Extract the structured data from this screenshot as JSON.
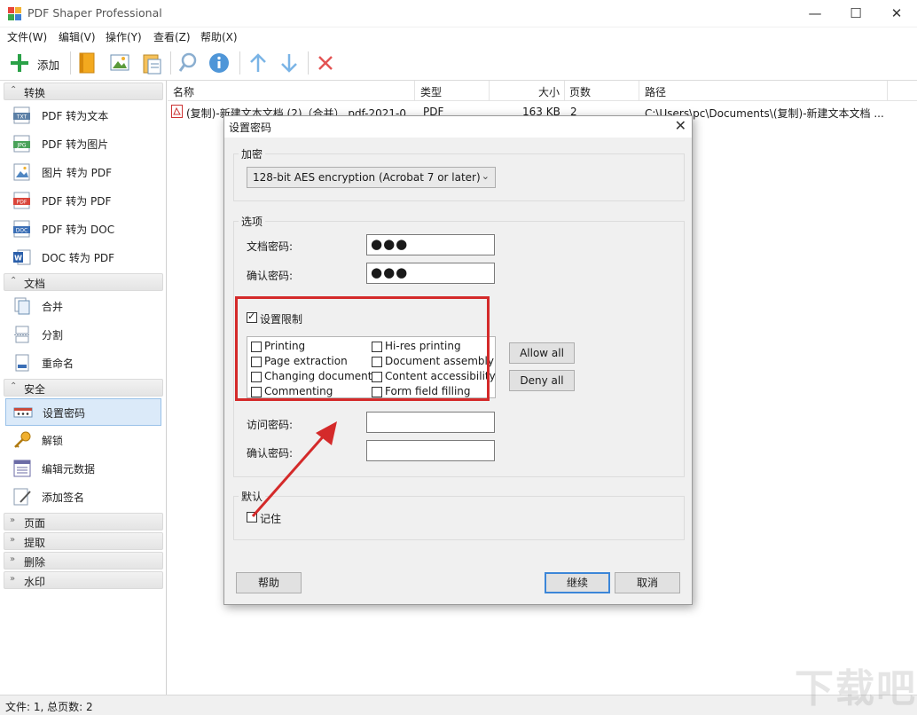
{
  "window": {
    "title": "PDF Shaper Professional",
    "minimize_glyph": "—",
    "maximize_glyph": "☐",
    "close_glyph": "✕"
  },
  "menu": [
    "文件(W)",
    "编辑(V)",
    "操作(Y)",
    "查看(Z)",
    "帮助(X)"
  ],
  "toolbar": {
    "add_label": "添加",
    "icons": [
      "add-icon",
      "bookmark-icon",
      "image-icon",
      "clipboard-icon",
      "search-icon",
      "info-icon",
      "move-up-icon",
      "move-down-icon",
      "remove-icon"
    ]
  },
  "sidebar": {
    "groups": [
      {
        "label": "转换",
        "arrow": "⌃",
        "items": [
          "PDF 转为文本",
          "PDF 转为图片",
          "图片 转为 PDF",
          "PDF 转为 PDF",
          "PDF 转为 DOC",
          "DOC 转为 PDF"
        ]
      },
      {
        "label": "文档",
        "arrow": "⌃",
        "items": [
          "合并",
          "分割",
          "重命名"
        ]
      },
      {
        "label": "安全",
        "arrow": "⌃",
        "items": [
          "设置密码",
          "解锁",
          "编辑元数据",
          "添加签名"
        ]
      },
      {
        "label": "页面",
        "arrow": "»",
        "items": []
      },
      {
        "label": "提取",
        "arrow": "»",
        "items": []
      },
      {
        "label": "删除",
        "arrow": "»",
        "items": []
      },
      {
        "label": "水印",
        "arrow": "»",
        "items": []
      }
    ],
    "selected_item": "设置密码"
  },
  "file_list": {
    "columns": [
      "名称",
      "类型",
      "大小",
      "页数",
      "路径"
    ],
    "rows": [
      {
        "name": "(复制)-新建文本文档 (2)（合并）.pdf-2021-0...",
        "type": "PDF",
        "size": "163 KB",
        "pages": "2",
        "path": "C:\\Users\\pc\\Documents\\(复制)-新建文本文档 ..."
      }
    ]
  },
  "status": "文件: 1, 总页数: 2",
  "dialog": {
    "title": "设置密码",
    "close_glyph": "✕",
    "encryption_group": "加密",
    "encryption_value": "128-bit AES encryption (Acrobat 7 or later)",
    "options_group": "选项",
    "doc_password_label": "文档密码:",
    "doc_password_value": "●●●",
    "confirm_password_label": "确认密码:",
    "confirm_password_value": "●●●",
    "set_restrictions_label": "设置限制",
    "set_restrictions_checked": true,
    "permissions": [
      {
        "label": "Printing",
        "checked": false
      },
      {
        "label": "Hi-res printing",
        "checked": false
      },
      {
        "label": "Page extraction",
        "checked": false
      },
      {
        "label": "Document assembly",
        "checked": false
      },
      {
        "label": "Changing document",
        "checked": false
      },
      {
        "label": "Content accessibility",
        "checked": false
      },
      {
        "label": "Commenting",
        "checked": false
      },
      {
        "label": "Form field filling",
        "checked": false
      }
    ],
    "allow_all_label": "Allow all",
    "deny_all_label": "Deny all",
    "access_password_label": "访问密码:",
    "access_confirm_label": "确认密码:",
    "default_group": "默认",
    "remember_label": "记住",
    "remember_checked": false,
    "help_label": "帮助",
    "continue_label": "继续",
    "cancel_label": "取消"
  },
  "colors": {
    "annotation_red": "#d42a2a",
    "selection_blue": "#dbeaf9",
    "default_button_border": "#3c86d8"
  }
}
